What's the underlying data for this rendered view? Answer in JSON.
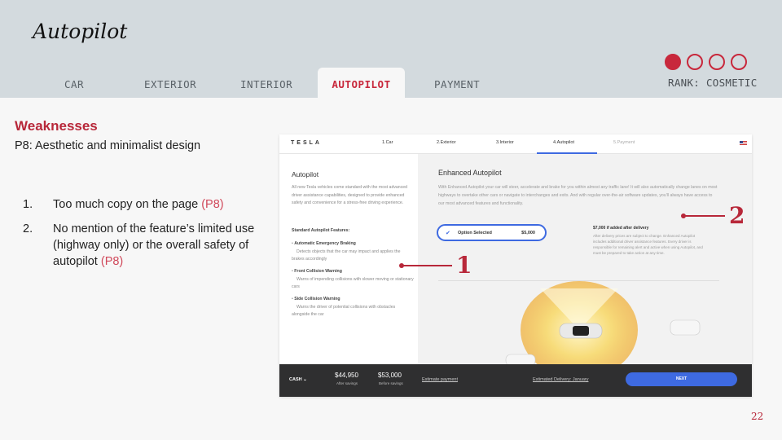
{
  "slide": {
    "title": "Autopilot",
    "page_number": "22"
  },
  "nav": {
    "tabs": [
      "CAR",
      "EXTERIOR",
      "INTERIOR",
      "AUTOPILOT",
      "PAYMENT"
    ],
    "active_tab": "AUTOPILOT",
    "progress_dots": {
      "filled": 1,
      "total": 4
    },
    "rank": "RANK: COSMETIC"
  },
  "content": {
    "heading": "Weaknesses",
    "subheading": "P8: Aesthetic and minimalist design",
    "items": [
      {
        "num": "1.",
        "text": "Too much copy on the page ",
        "tag": "(P8)"
      },
      {
        "num": "2.",
        "text": "No mention of the feature’s limited use (highway only) or the overall safety of autopilot ",
        "tag": "(P8)"
      }
    ]
  },
  "callouts": [
    "1",
    "2"
  ],
  "screenshot": {
    "logo": "TESLA",
    "tabs": [
      "1.Car",
      "2.Exterior",
      "3.Interior",
      "4.Autopilot",
      "5.Payment"
    ],
    "left": {
      "heading": "Autopilot",
      "intro": "All new Tesla vehicles come standard with the most advanced driver assistance capabilities, designed to provide enhanced safety and convenience for a stress-free driving experience.",
      "features_heading": "Standard Autopilot Features:",
      "features": [
        {
          "name": "Automatic Emergency Braking",
          "desc": "Detects objects that the car may impact and applies the brakes accordingly"
        },
        {
          "name": "Front Collision Warning",
          "desc": "Warns of impending collisions with slower moving or stationary cars"
        },
        {
          "name": "Side Collision Warning",
          "desc": "Warns the driver of potential collisions with obstacles alongside the car"
        }
      ]
    },
    "right": {
      "heading": "Enhanced Autopilot",
      "description": "With Enhanced Autopilot your car will steer, accelerate and brake for you within almost any traffic lane! It will also automatically change lanes on most highways to overtake other cars or navigate to interchanges and exits. And with regular over-the-air software updates, you'll always have access to our most advanced features and functionality.",
      "option_label": "Option Selected",
      "option_price": "$5,000",
      "price_note": "$7,000 if added after delivery",
      "price_detail": "After delivery prices are subject to change. Enhanced Autopilot includes additional driver assistance features. Every driver is responsible for remaining alert and active when using Autopilot, and must be prepared to take action at any time."
    },
    "bottom": {
      "payment_type": "CASH",
      "price_after": "$44,950",
      "price_after_label": "After savings",
      "price_before": "$53,000",
      "price_before_label": "Before savings",
      "estimate_link": "Estimate payment",
      "delivery_link": "Estimated Delivery: January",
      "next_label": "NEXT"
    }
  },
  "colors": {
    "accent_red": "#c8283c",
    "header_bg": "#d3dade",
    "tesla_blue": "#3e6ae1"
  }
}
